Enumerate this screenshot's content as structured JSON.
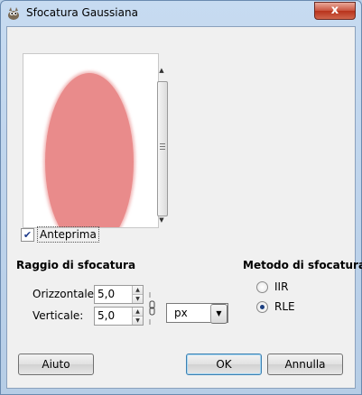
{
  "window": {
    "title": "Sfocatura Gaussiana",
    "close_symbol": "x"
  },
  "preview": {
    "checkbox_label": "Anteprima",
    "checked": true,
    "ellipse_color": "#e98b8b"
  },
  "radius": {
    "section_title": "Raggio di sfocatura",
    "horizontal_label": "Orizzontale:",
    "horizontal_value": "5,0",
    "vertical_label": "Verticale:",
    "vertical_value": "5,0",
    "unit": "px"
  },
  "method": {
    "section_title": "Metodo di sfocatura",
    "options": [
      {
        "label": "IIR",
        "selected": false
      },
      {
        "label": "RLE",
        "selected": true
      }
    ]
  },
  "buttons": {
    "help": "Aiuto",
    "ok": "OK",
    "cancel": "Annulla"
  },
  "colors": {
    "window_frame": "#b9d1ea",
    "client_bg": "#f0f0f0",
    "close_button": "#c9533e"
  }
}
